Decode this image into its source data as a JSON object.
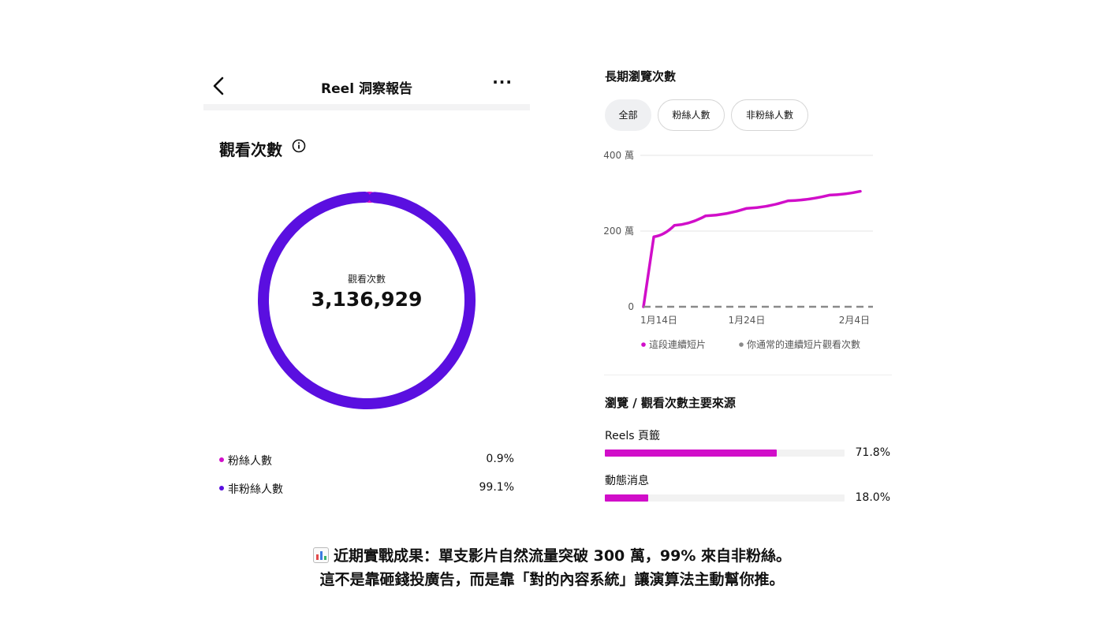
{
  "header": {
    "title": "Reel 洞察報告"
  },
  "views": {
    "section_title": "觀看次數",
    "donut_label": "觀看次數",
    "total": "3,136,929",
    "legend": [
      {
        "label": "粉絲人數",
        "pct": "0.9%",
        "value": 0.9,
        "color": "#d10ec9"
      },
      {
        "label": "非粉絲人數",
        "pct": "99.1%",
        "value": 99.1,
        "color": "#5a0fe0"
      }
    ]
  },
  "long_term": {
    "title": "長期瀏覽次數",
    "filters": [
      {
        "label": "全部",
        "active": true
      },
      {
        "label": "粉絲人數",
        "active": false
      },
      {
        "label": "非粉絲人數",
        "active": false
      }
    ]
  },
  "chart_data": {
    "type": "line",
    "title": "",
    "ylim": [
      0,
      4000000
    ],
    "y_ticks": [
      {
        "value": 4000000,
        "label": "400 萬"
      },
      {
        "value": 2000000,
        "label": "200 萬"
      },
      {
        "value": 0,
        "label": "0"
      }
    ],
    "x_ticks": [
      "1月14日",
      "1月24日",
      "2月4日"
    ],
    "grid": true,
    "legend_position": "bottom",
    "series": [
      {
        "name": "這段連續短片",
        "color": "#d10ec9",
        "dashed": false,
        "x": [
          "1月14日",
          "1月15日",
          "1月17日",
          "1月20日",
          "1月24日",
          "1月28日",
          "2月1日",
          "2月4日"
        ],
        "values": [
          0,
          1850000,
          2150000,
          2400000,
          2600000,
          2800000,
          2950000,
          3050000
        ]
      },
      {
        "name": "你通常的連續短片觀看次數",
        "color": "#8a8a8a",
        "dashed": true,
        "x": [
          "1月14日",
          "2月4日"
        ],
        "values": [
          0,
          0
        ]
      }
    ]
  },
  "sources": {
    "title": "瀏覽 / 觀看次數主要來源",
    "items": [
      {
        "label": "Reels 頁籤",
        "pct": "71.8%",
        "value": 71.8
      },
      {
        "label": "動態消息",
        "pct": "18.0%",
        "value": 18.0
      }
    ]
  },
  "caption": {
    "icon": "bar-chart-emoji",
    "line1": "近期實戰成果：單支影片自然流量突破 300 萬，99% 來自非粉絲。",
    "line2": "這不是靠砸錢投廣告，而是靠「對的內容系統」讓演算法主動幫你推。"
  }
}
